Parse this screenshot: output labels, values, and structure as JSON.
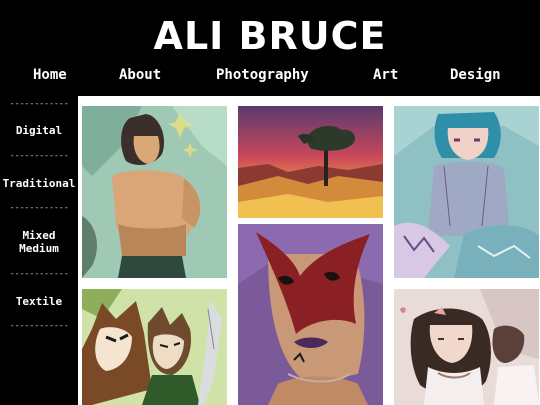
{
  "site": {
    "title": "ALI BRUCE"
  },
  "nav": [
    {
      "label": "Home"
    },
    {
      "label": "About"
    },
    {
      "label": "Photography"
    },
    {
      "label": "Art"
    },
    {
      "label": "Design"
    }
  ],
  "sidebar": {
    "separator": "------------",
    "items": [
      {
        "label": "Digital"
      },
      {
        "label": "Traditional"
      },
      {
        "label": "Mixed\nMedium"
      },
      {
        "label": "Textile"
      }
    ]
  },
  "colors": {
    "background": "#000000",
    "text": "#ffffff",
    "gallery": "#ffffff"
  },
  "gallery": [
    {
      "icon": "artwork-digital-figure-icon"
    },
    {
      "icon": "artwork-sunset-tree-icon"
    },
    {
      "icon": "artwork-blue-hair-girl-icon"
    },
    {
      "icon": "artwork-animal-characters-icon"
    },
    {
      "icon": "artwork-red-mask-portrait-icon"
    },
    {
      "icon": "artwork-curly-hair-girl-icon"
    }
  ]
}
